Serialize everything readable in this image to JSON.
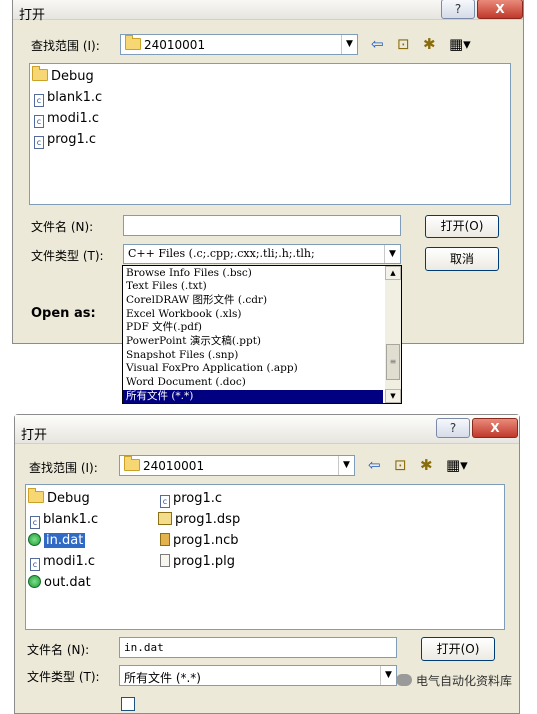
{
  "dialog1": {
    "title": "打开",
    "help_label": "?",
    "close_label": "X",
    "lookin_label": "查找范围 (I):",
    "lookin_value": "24010001",
    "files": [
      {
        "name": "Debug",
        "icon": "folder-icon"
      },
      {
        "name": "blank1.c",
        "icon": "c-file-icon"
      },
      {
        "name": "modi1.c",
        "icon": "c-file-icon"
      },
      {
        "name": "prog1.c",
        "icon": "c-file-icon"
      }
    ],
    "filename_label": "文件名 (N):",
    "filename_value": "",
    "filetype_label": "文件类型 (T):",
    "filetype_value": "C++ Files (.c;.cpp;.cxx;.tli;.h;.tlh;",
    "open_as_label": "Open as:",
    "open_button": "打开(O)",
    "cancel_button": "取消",
    "type_options": [
      "Browse Info Files (.bsc)",
      "Text Files (.txt)",
      "CorelDRAW 图形文件 (.cdr)",
      "Excel Workbook (.xls)",
      "PDF 文件(.pdf)",
      "PowerPoint 演示文稿(.ppt)",
      "Snapshot Files (.snp)",
      "Visual FoxPro Application (.app)",
      "Word Document (.doc)",
      "所有文件 (*.*)"
    ],
    "selected_option_index": 9
  },
  "dialog2": {
    "title": "打开",
    "help_label": "?",
    "close_label": "X",
    "lookin_label": "查找范围 (I):",
    "lookin_value": "24010001",
    "files_col1": [
      {
        "name": "Debug",
        "icon": "folder-icon"
      },
      {
        "name": "blank1.c",
        "icon": "c-file-icon"
      },
      {
        "name": "in.dat",
        "icon": "dat-file-icon",
        "selected": true
      },
      {
        "name": "modi1.c",
        "icon": "c-file-icon"
      },
      {
        "name": "out.dat",
        "icon": "dat-file-icon"
      }
    ],
    "files_col2": [
      {
        "name": "prog1.c",
        "icon": "c-file-icon"
      },
      {
        "name": "prog1.dsp",
        "icon": "dsp-file-icon"
      },
      {
        "name": "prog1.ncb",
        "icon": "ncb-file-icon"
      },
      {
        "name": "prog1.plg",
        "icon": "plg-file-icon"
      }
    ],
    "filename_label": "文件名 (N):",
    "filename_value": "in.dat",
    "filetype_label": "文件类型 (T):",
    "filetype_value": "所有文件 (*.*)",
    "open_button": "打开(O)"
  },
  "watermark": "电气自动化资料库"
}
